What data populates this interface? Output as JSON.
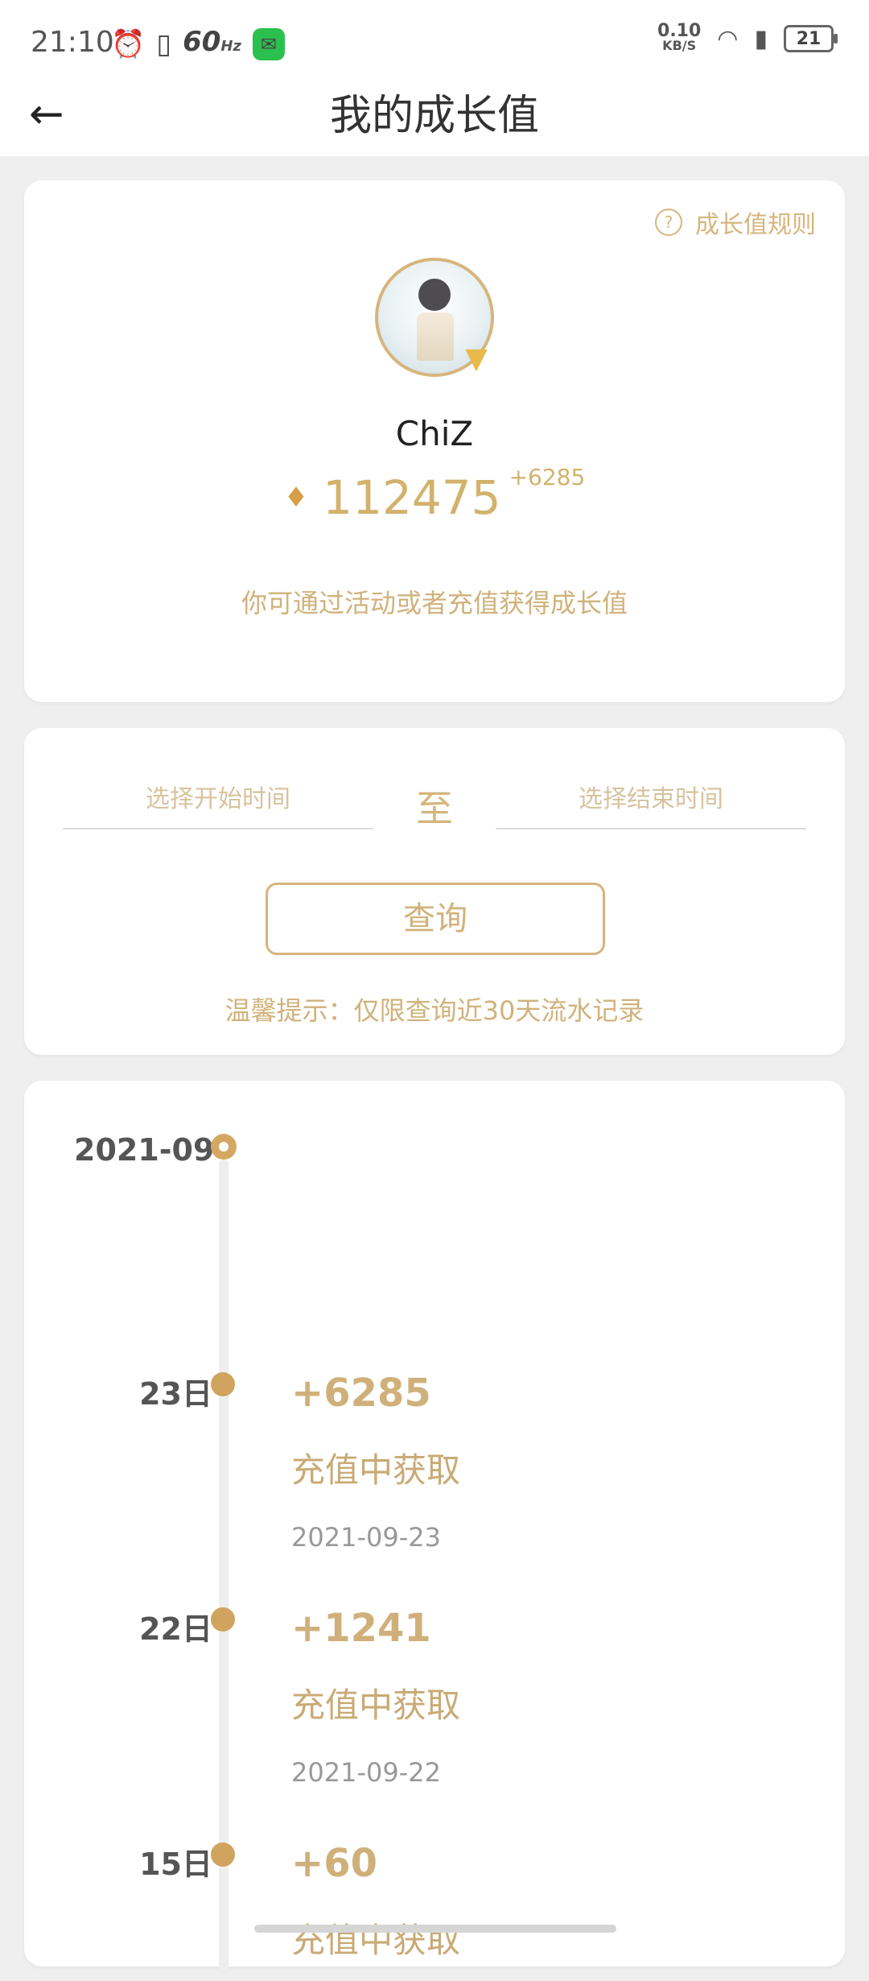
{
  "status_bar": {
    "time": "21:10",
    "refresh_rate": "60",
    "refresh_unit": "Hz",
    "net_speed_value": "0.10",
    "net_speed_unit": "KB/S",
    "battery": "21"
  },
  "header": {
    "title": "我的成长值"
  },
  "profile": {
    "rules_label": "成长值规则",
    "username": "ChiZ",
    "growth_value": "112475",
    "growth_delta": "+6285",
    "hint": "你可通过活动或者充值获得成长值"
  },
  "query": {
    "start_placeholder": "选择开始时间",
    "to_label": "至",
    "end_placeholder": "选择结束时间",
    "button_label": "查询",
    "tip": "温馨提示：仅限查询近30天流水记录"
  },
  "timeline": {
    "month": "2021-09",
    "entries": [
      {
        "day": "23日",
        "amount": "+6285",
        "source": "充值中获取",
        "date": "2021-09-23"
      },
      {
        "day": "22日",
        "amount": "+1241",
        "source": "充值中获取",
        "date": "2021-09-22"
      },
      {
        "day": "15日",
        "amount": "+60",
        "source": "充值中获取",
        "date": ""
      }
    ]
  },
  "colors": {
    "accent_gold": "#d6b57c",
    "background": "#efefef"
  }
}
